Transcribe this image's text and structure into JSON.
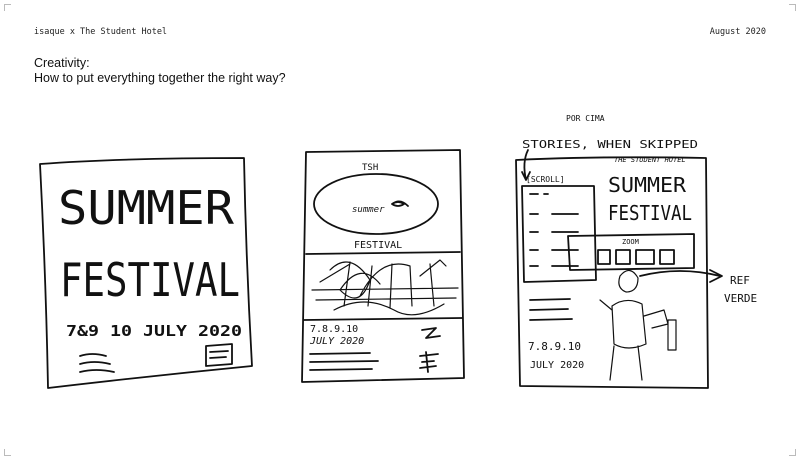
{
  "header": {
    "left": "isaque x The Student Hotel",
    "right": "August 2020"
  },
  "title": {
    "line1": "Creativity:",
    "line2": "How to put everything together the right way?"
  },
  "sketches": {
    "left": {
      "headline_top": "SUMMER",
      "headline_bottom": "FESTIVAL",
      "dates": "7&9 10 JULY 2020"
    },
    "middle": {
      "top_label": "TSH",
      "oval_text": "summer",
      "festival_label": "FESTIVAL",
      "dates_line1": "7.8.9.10",
      "dates_line2": "JULY 2020"
    },
    "right": {
      "note_top": "POR CIMA",
      "note_stories": "STORIES, WHEN SKIPPED",
      "scroll_label": "[SCROLL]",
      "brand_small": "THE STUDENT HOTEL",
      "headline_top": "SUMMER",
      "headline_bottom": "FESTIVAL",
      "zoom_label": "ZOOM",
      "side_note_1": "REF",
      "side_note_2": "VERDE",
      "dates_line1": "7.8.9.10",
      "dates_line2": "JULY 2020"
    }
  }
}
